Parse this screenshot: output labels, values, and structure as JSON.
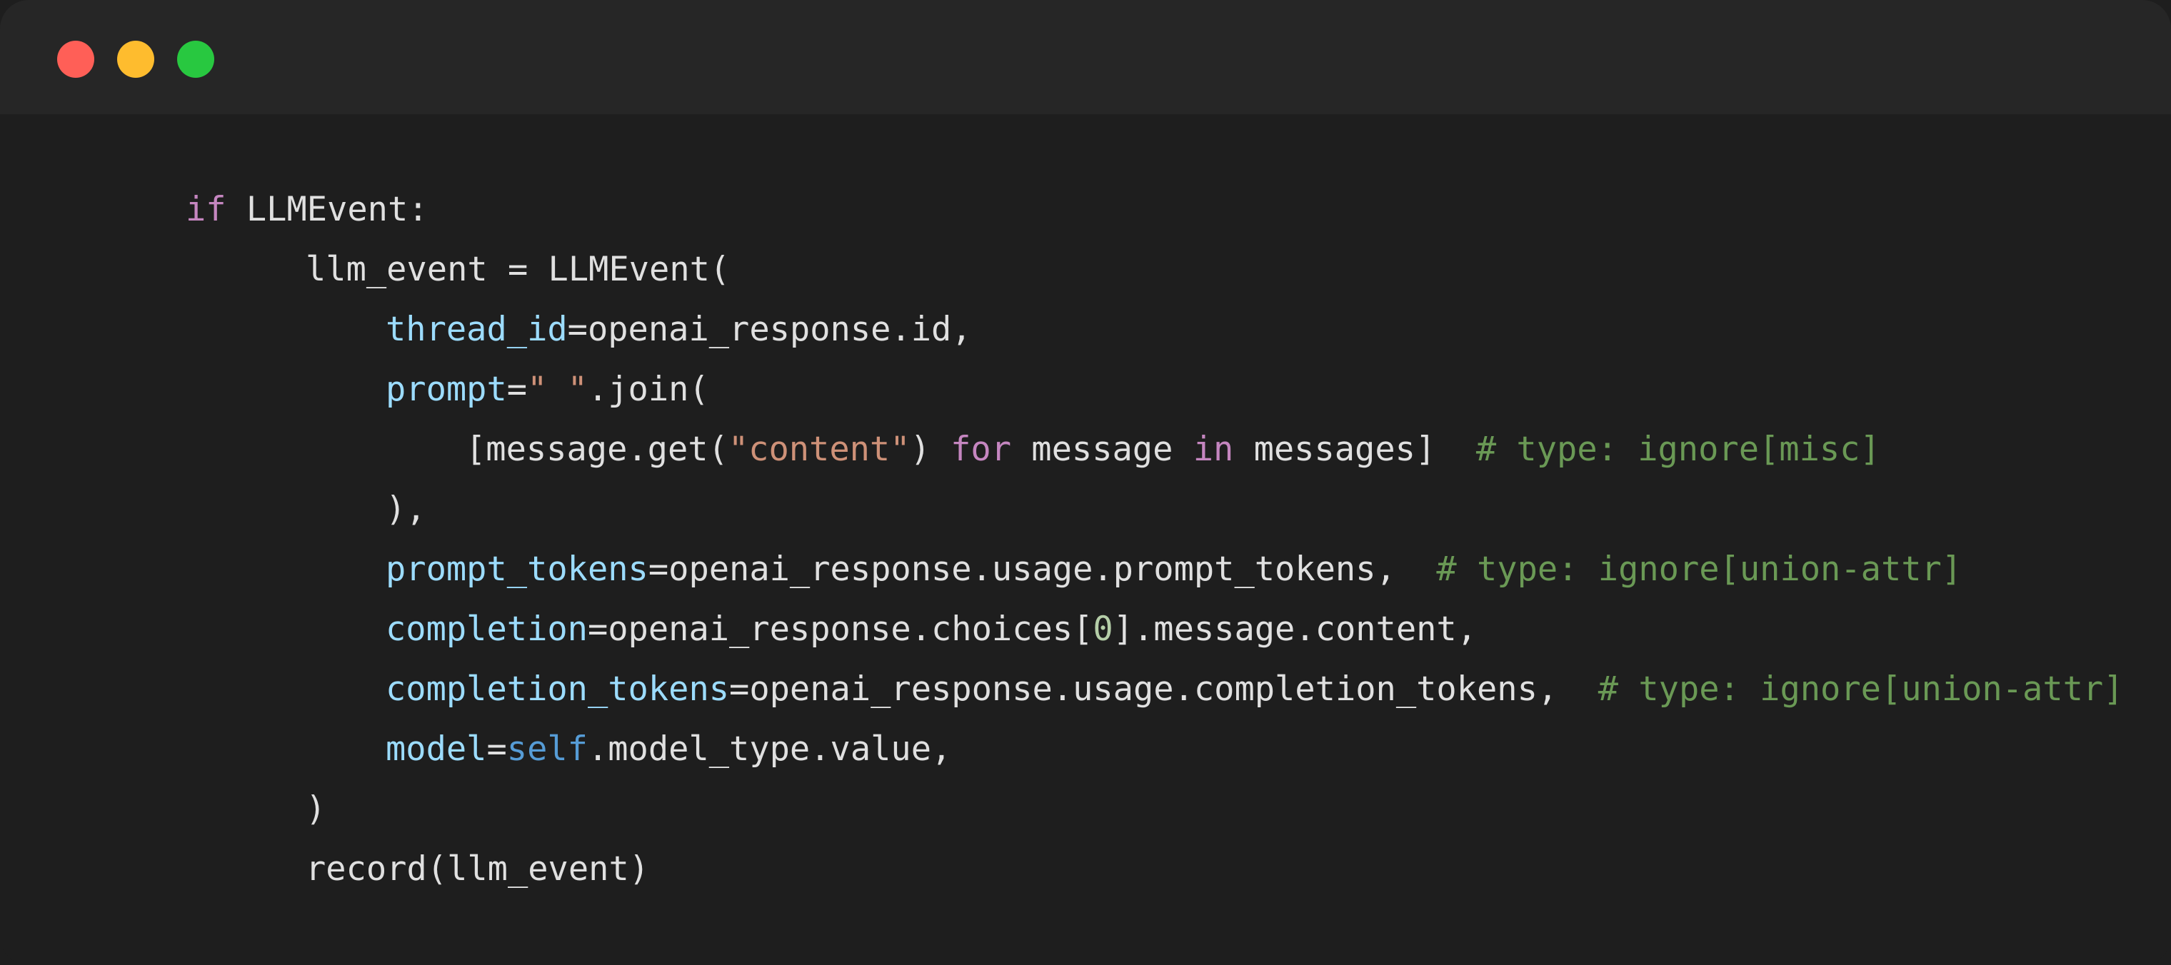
{
  "window": {
    "controls": [
      {
        "name": "close",
        "color": "#ff5f57"
      },
      {
        "name": "minimize",
        "color": "#febc2e"
      },
      {
        "name": "maximize",
        "color": "#28c840"
      }
    ]
  },
  "colors": {
    "default": "#e0e0e0",
    "keyword": "#c586c0",
    "param": "#9cdcfe",
    "string": "#ce9178",
    "comment": "#6a9955",
    "number": "#b5cea8",
    "self": "#569cd6"
  },
  "code": {
    "lines": [
      {
        "indent": 260,
        "tokens": [
          {
            "t": "if",
            "k": "keyword"
          },
          {
            "t": " LLMEvent:",
            "k": "default"
          }
        ]
      },
      {
        "indent": 428,
        "tokens": [
          {
            "t": "llm_event = LLMEvent(",
            "k": "default"
          }
        ]
      },
      {
        "indent": 540,
        "tokens": [
          {
            "t": "thread_id",
            "k": "param"
          },
          {
            "t": "=openai_response.id,",
            "k": "default"
          }
        ]
      },
      {
        "indent": 540,
        "tokens": [
          {
            "t": "prompt",
            "k": "param"
          },
          {
            "t": "=",
            "k": "default"
          },
          {
            "t": "\" \"",
            "k": "string"
          },
          {
            "t": ".join(",
            "k": "default"
          }
        ]
      },
      {
        "indent": 652,
        "tokens": [
          {
            "t": "[message.get(",
            "k": "default"
          },
          {
            "t": "\"content\"",
            "k": "string"
          },
          {
            "t": ") ",
            "k": "default"
          },
          {
            "t": "for",
            "k": "keyword"
          },
          {
            "t": " message ",
            "k": "default"
          },
          {
            "t": "in",
            "k": "keyword"
          },
          {
            "t": " messages]  ",
            "k": "default"
          },
          {
            "t": "# type: ignore[misc]",
            "k": "comment"
          }
        ]
      },
      {
        "indent": 540,
        "tokens": [
          {
            "t": "),",
            "k": "default"
          }
        ]
      },
      {
        "indent": 540,
        "tokens": [
          {
            "t": "prompt_tokens",
            "k": "param"
          },
          {
            "t": "=openai_response.usage.prompt_tokens,  ",
            "k": "default"
          },
          {
            "t": "# type: ignore[union-attr]",
            "k": "comment"
          }
        ]
      },
      {
        "indent": 540,
        "tokens": [
          {
            "t": "completion",
            "k": "param"
          },
          {
            "t": "=openai_response.choices[",
            "k": "default"
          },
          {
            "t": "0",
            "k": "number"
          },
          {
            "t": "].message.content,",
            "k": "default"
          }
        ]
      },
      {
        "indent": 540,
        "tokens": [
          {
            "t": "completion_tokens",
            "k": "param"
          },
          {
            "t": "=openai_response.usage.completion_tokens,  ",
            "k": "default"
          },
          {
            "t": "# type: ignore[union-attr]",
            "k": "comment"
          }
        ]
      },
      {
        "indent": 540,
        "tokens": [
          {
            "t": "model",
            "k": "param"
          },
          {
            "t": "=",
            "k": "default"
          },
          {
            "t": "self",
            "k": "self"
          },
          {
            "t": ".model_type.value,",
            "k": "default"
          }
        ]
      },
      {
        "indent": 428,
        "tokens": [
          {
            "t": ")",
            "k": "default"
          }
        ]
      },
      {
        "indent": 428,
        "tokens": [
          {
            "t": "record(llm_event)",
            "k": "default"
          }
        ]
      }
    ]
  }
}
